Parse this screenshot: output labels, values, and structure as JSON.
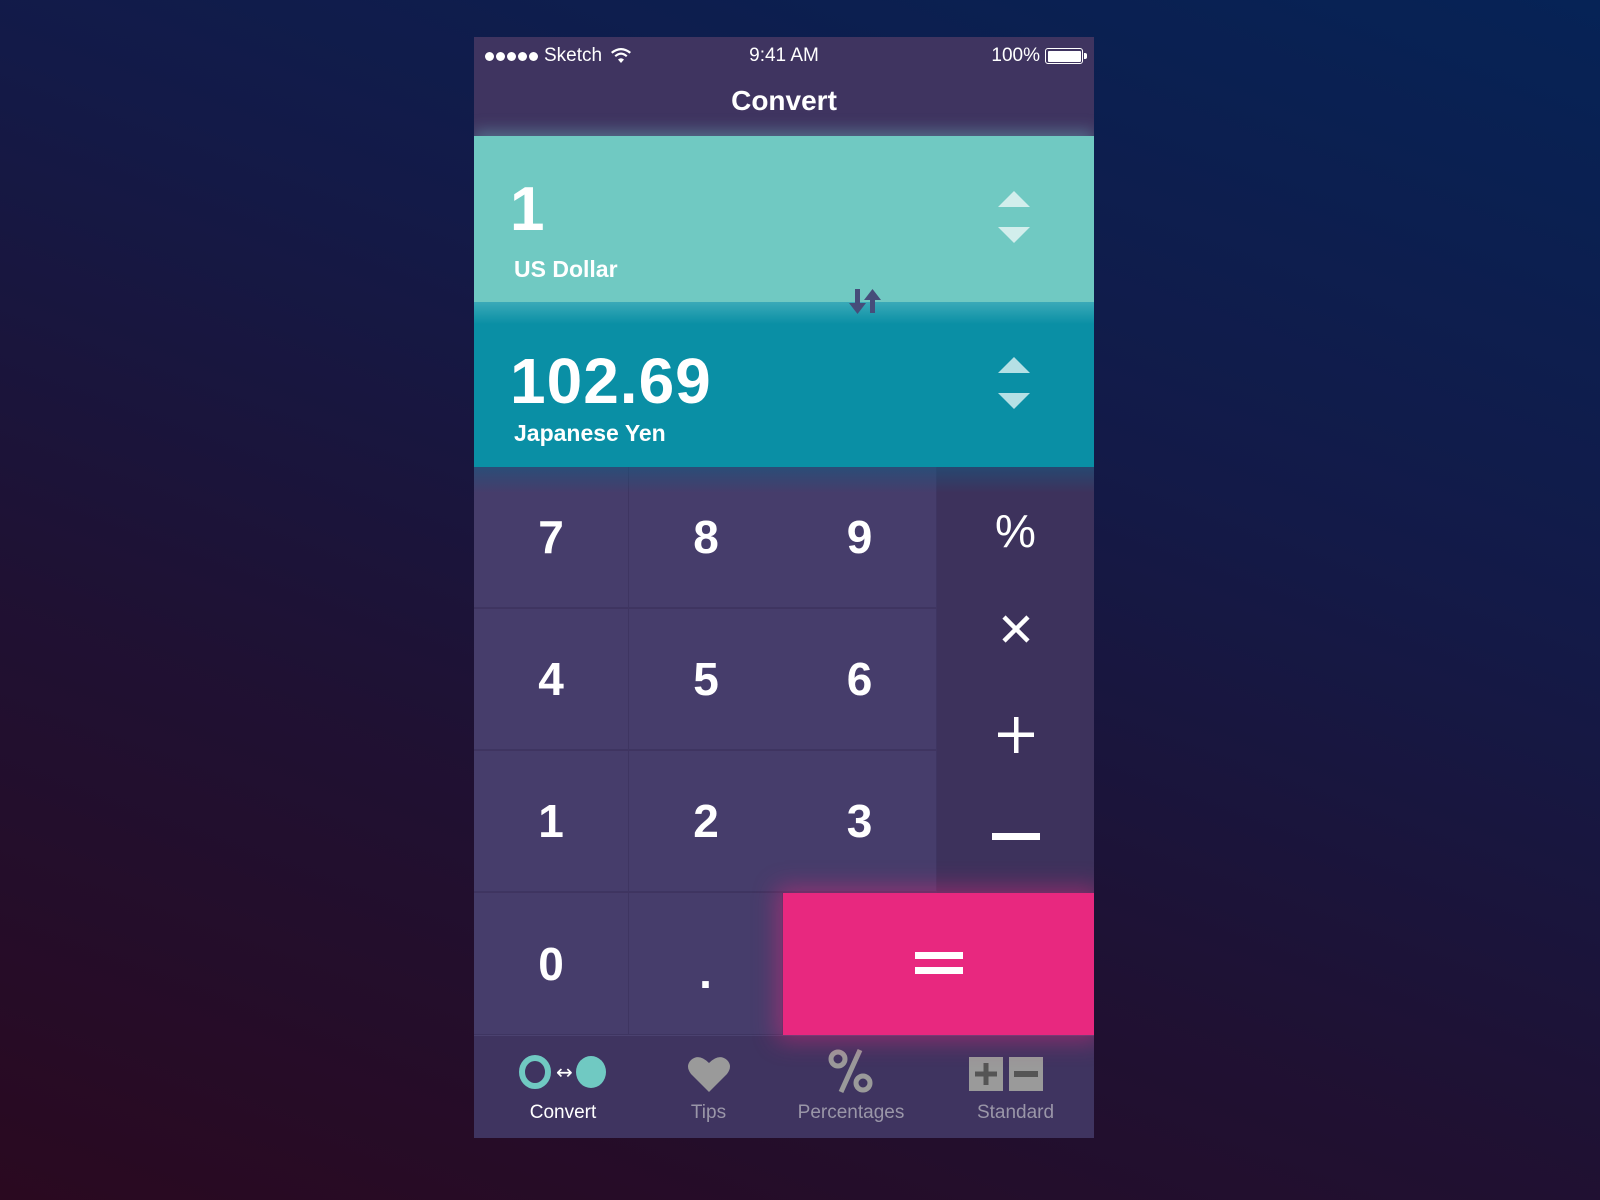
{
  "status_bar": {
    "signal_dots": 5,
    "carrier": "Sketch",
    "time": "9:41 AM",
    "battery_percent": "100%",
    "battery_level": 1.0
  },
  "nav": {
    "title": "Convert"
  },
  "converter": {
    "from": {
      "amount": "1",
      "currency": "US Dollar"
    },
    "to": {
      "amount": "102.69",
      "currency": "Japanese Yen"
    },
    "swap_icon": "swap-vertical-arrows-icon",
    "stepper_icons": [
      "triangle-up-icon",
      "triangle-down-icon"
    ]
  },
  "keypad": {
    "digits": [
      [
        "7",
        "8",
        "9"
      ],
      [
        "4",
        "5",
        "6"
      ],
      [
        "1",
        "2",
        "3"
      ],
      [
        "0",
        "."
      ]
    ],
    "operators": {
      "percent": "%",
      "multiply": "×",
      "add": "+",
      "subtract": "−"
    },
    "equals": "="
  },
  "tab_bar": {
    "active": "Convert",
    "tabs": [
      {
        "label": "Convert",
        "icon": "convert-circles-icon"
      },
      {
        "label": "Tips",
        "icon": "heart-icon"
      },
      {
        "label": "Percentages",
        "icon": "percent-icon"
      },
      {
        "label": "Standard",
        "icon": "plus-minus-icon"
      }
    ]
  },
  "colors": {
    "from_panel": "#70c9c2",
    "to_panel": "#0a8fa5",
    "keypad": "#463d6b",
    "operator_column": "#3d325c",
    "equals": "#e8287f",
    "active_tab_accent": "#70c9c2",
    "inactive_tab": "#9a96a8"
  }
}
